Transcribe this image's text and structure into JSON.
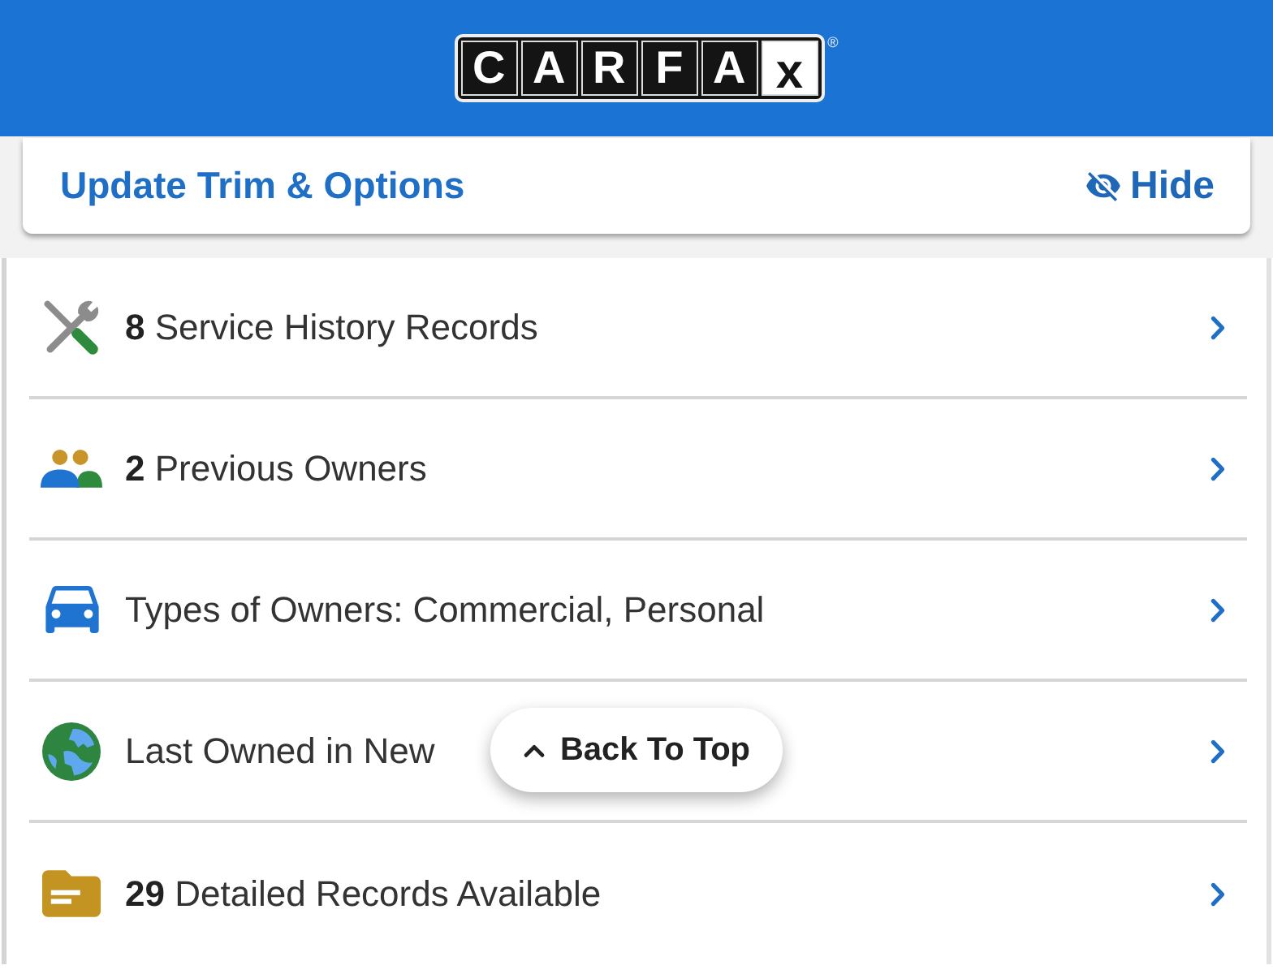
{
  "header": {
    "logo": {
      "letters": [
        {
          "char": "C",
          "inverted": false
        },
        {
          "char": "A",
          "inverted": false
        },
        {
          "char": "R",
          "inverted": false
        },
        {
          "char": "F",
          "inverted": false
        },
        {
          "char": "A",
          "inverted": false
        },
        {
          "char": "x",
          "inverted": true
        }
      ],
      "registered_mark": "®"
    }
  },
  "options_card": {
    "title": "Update Trim & Options",
    "hide_button": "Hide"
  },
  "rows": [
    {
      "kind": "service",
      "text": "**8** Service History Records"
    },
    {
      "kind": "owners",
      "text": "**2** Previous Owners"
    },
    {
      "kind": "car",
      "text": "Types of Owners: Commercial, Personal"
    },
    {
      "kind": "globe",
      "text": "Last Owned in New"
    },
    {
      "kind": "folder",
      "text": "**29** Detailed Records Available"
    }
  ],
  "back_to_top": {
    "label": "Back To Top"
  }
}
